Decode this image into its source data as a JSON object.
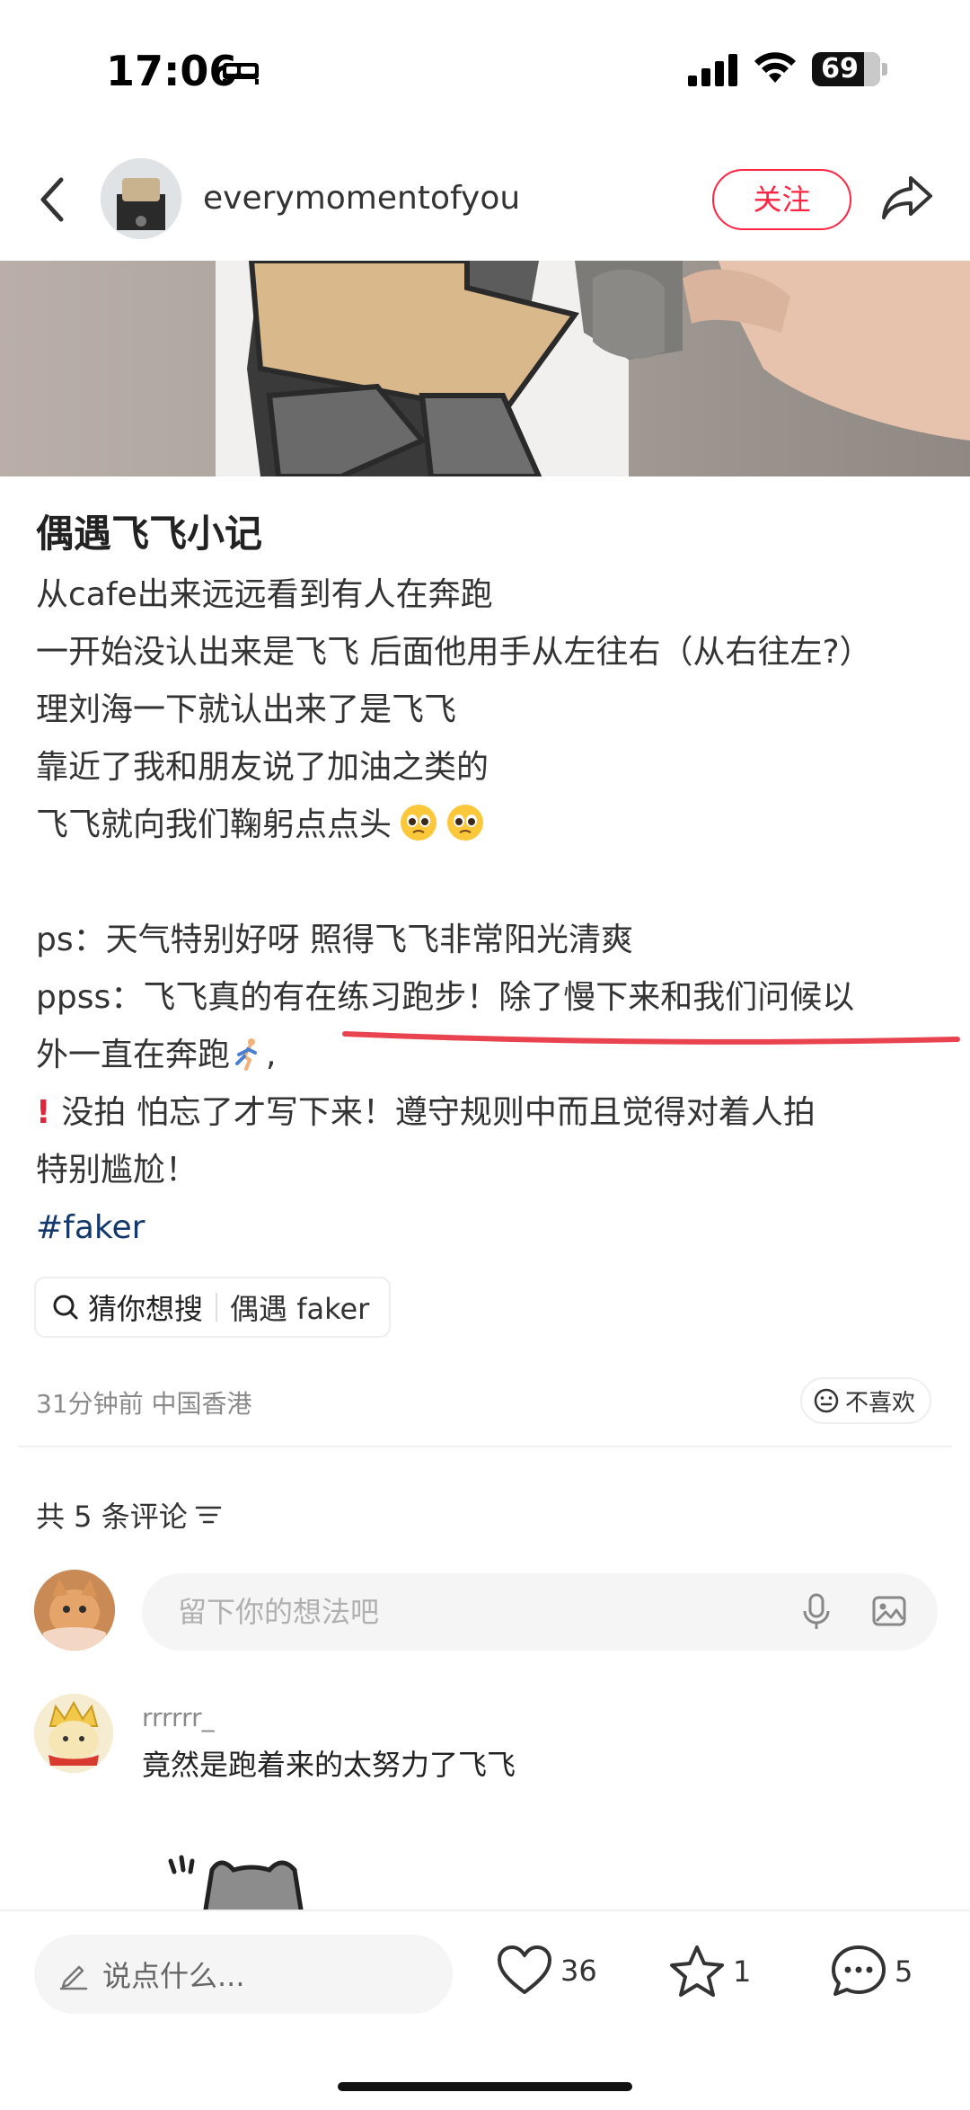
{
  "status_bar": {
    "time": "17:06",
    "battery": "69"
  },
  "header": {
    "username": "everymomentofyou",
    "follow_label": "关注"
  },
  "post": {
    "title": "偶遇飞飞小记",
    "lines": [
      "从cafe出来远远看到有人在奔跑",
      "一开始没认出来是飞飞 后面他用手从左往右（从右往左?）",
      "理刘海一下就认出来了是飞飞",
      "靠近了我和朋友说了加油之类的",
      "飞飞就向我们鞠躬点点头",
      "ps：天气特别好呀 照得飞飞非常阳光清爽",
      "ppss：飞飞真的有在练习跑步！除了慢下来和我们问候以",
      "外一直在奔跑",
      "没拍 怕忘了才写下来！遵守规则中而且觉得对着人拍",
      "特别尴尬！"
    ],
    "hashtag": "#faker",
    "search_chip_label": "猜你想搜",
    "search_chip_query": "偶遇 faker",
    "time_location": "31分钟前 中国香港",
    "dislike_label": "不喜欢"
  },
  "comments": {
    "count_label": "共 5 条评论",
    "input_placeholder": "留下你的想法吧",
    "items": [
      {
        "author": "rrrrrr_",
        "text": "竟然是跑着来的太努力了飞飞"
      }
    ]
  },
  "bottom_bar": {
    "input_placeholder": "说点什么...",
    "likes": "36",
    "collects": "1",
    "comments": "5"
  }
}
